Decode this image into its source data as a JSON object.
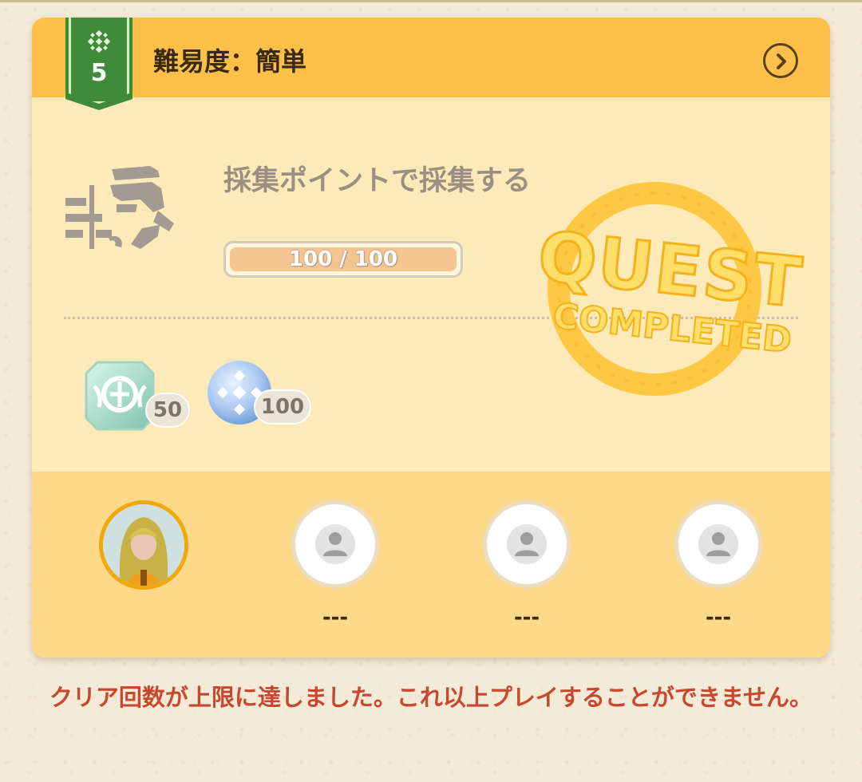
{
  "header": {
    "level": "5",
    "difficulty": "難易度：簡単",
    "badge_icon": "crystal-snowflake-icon",
    "detail_icon": "chevron-right-circle-icon"
  },
  "quest": {
    "icon": "gathering-point-icon",
    "title": "採集ポイントで採集する",
    "progress_text": "100 / 100",
    "progress_current": 100,
    "progress_max": 100,
    "stamp_line1": "QUEST",
    "stamp_line2": "COMPLETED"
  },
  "rewards": [
    {
      "icon": "crystal-emblem-icon",
      "count": "50"
    },
    {
      "icon": "blue-orb-icon",
      "count": "100"
    }
  ],
  "party": {
    "members": [
      {
        "name": "",
        "avatar": "player-avatar"
      },
      {
        "name": "---",
        "avatar": "empty-user-icon"
      },
      {
        "name": "---",
        "avatar": "empty-user-icon"
      },
      {
        "name": "---",
        "avatar": "empty-user-icon"
      }
    ]
  },
  "notice": "クリア回数が上限に達しました。これ以上プレイすることができません。",
  "colors": {
    "header": "#ffc04a",
    "card": "#fdeab8",
    "party_bg": "#ffd98a",
    "badge_green": "#3f8b3a",
    "notice_red": "#c8472f",
    "stamp": "#ffc43a"
  }
}
